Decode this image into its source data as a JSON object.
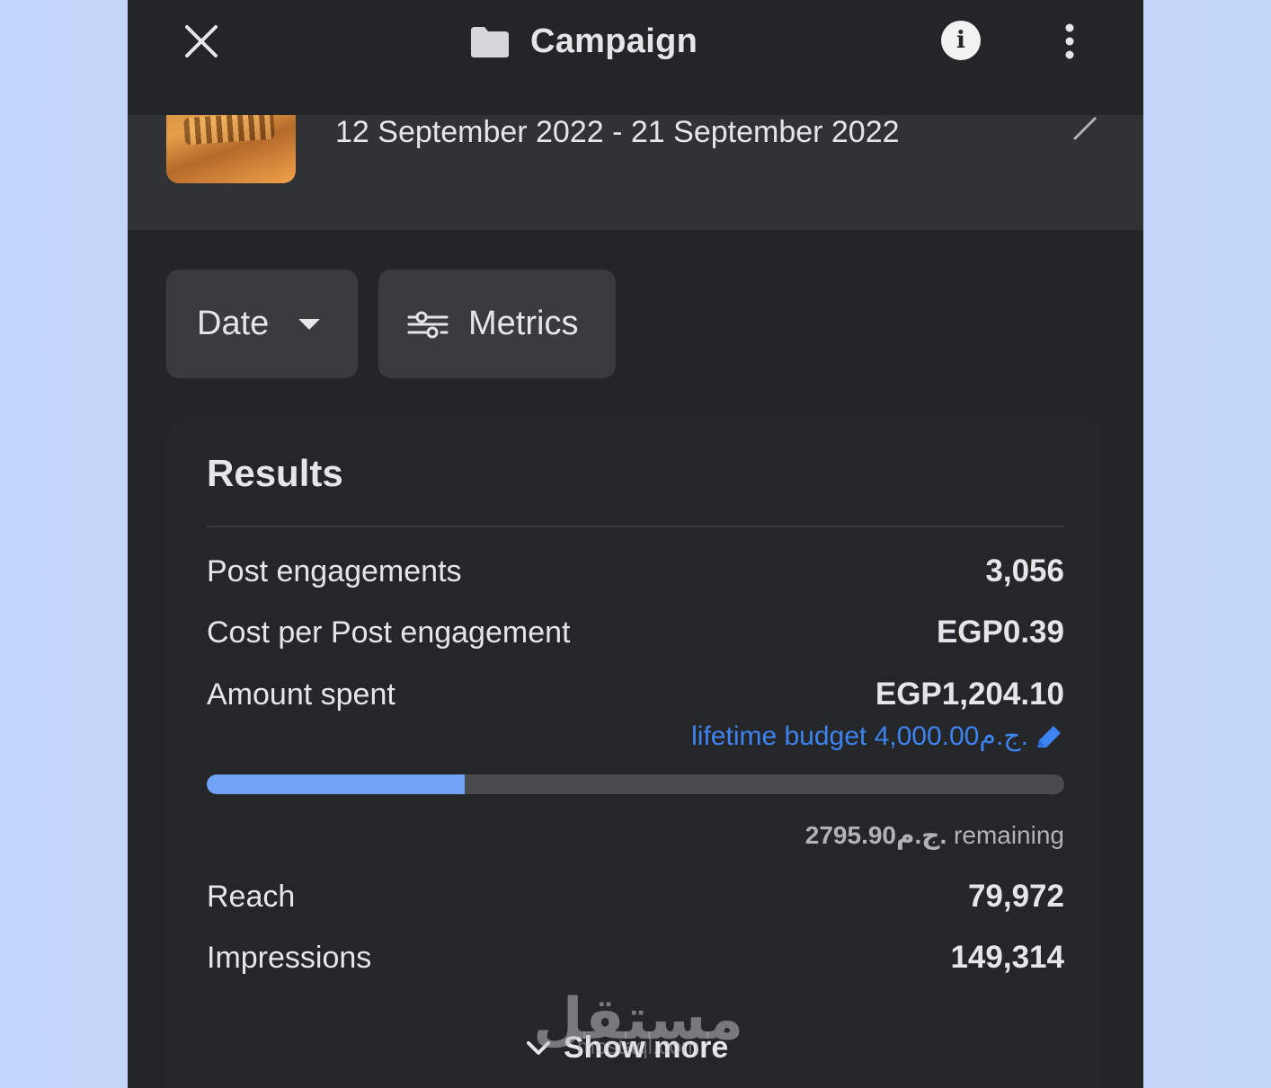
{
  "app": {
    "title": "Campaign"
  },
  "campaign": {
    "date_range": "12 September 2022 - 21 September 2022"
  },
  "filters": {
    "date_label": "Date",
    "metrics_label": "Metrics"
  },
  "results": {
    "title": "Results",
    "rows": [
      {
        "label": "Post engagements",
        "value": "3,056"
      },
      {
        "label": "Cost per Post engagement",
        "value": "EGP0.39"
      },
      {
        "label": "Amount spent",
        "value": "EGP1,204.10"
      }
    ],
    "budget_text": "lifetime budget 4,000.00ج.م.",
    "budget_progress_fraction": 0.301,
    "remaining_amount": "2795.90ج.م.",
    "remaining_word": "remaining",
    "rows2": [
      {
        "label": "Reach",
        "value": "79,972"
      },
      {
        "label": "Impressions",
        "value": "149,314"
      }
    ],
    "show_more_label": "Show more"
  },
  "watermark": {
    "arabic": "مستقل",
    "latin": "mostaql.com"
  },
  "colors": {
    "accent_link": "#3d83f2",
    "progress_fill": "#70a2f5"
  }
}
